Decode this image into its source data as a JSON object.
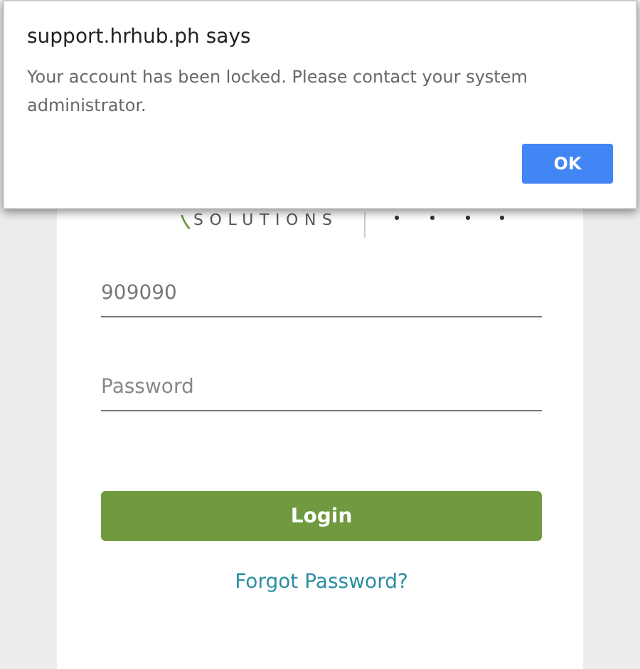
{
  "dialog": {
    "title": "support.hrhub.ph says",
    "message": "Your account has been locked. Please contact your system administrator.",
    "buttons": [
      "OK"
    ]
  },
  "logo": {
    "text": "SOLUTIONS"
  },
  "form": {
    "username": {
      "value": "909090"
    },
    "password": {
      "placeholder": "Password"
    },
    "login_button": "Login",
    "forgot_link": "Forgot Password?"
  }
}
